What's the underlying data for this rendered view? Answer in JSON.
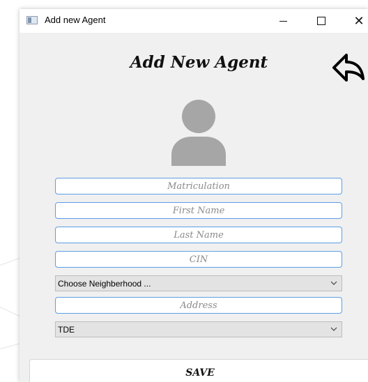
{
  "window": {
    "title": "Add new Agent",
    "minimize_icon": "minimize-icon",
    "maximize_icon": "maximize-icon",
    "close_icon": "close-icon"
  },
  "form": {
    "heading": "Add New Agent",
    "back_icon": "back-arrow-icon",
    "avatar_icon": "user-avatar-icon",
    "fields": {
      "matriculation": {
        "placeholder": "Matriculation",
        "value": ""
      },
      "first_name": {
        "placeholder": "First Name",
        "value": ""
      },
      "last_name": {
        "placeholder": "Last Name",
        "value": ""
      },
      "cin": {
        "placeholder": "CIN",
        "value": ""
      },
      "neighborhood": {
        "selected": "Choose Neighberhood ..."
      },
      "address": {
        "placeholder": "Address",
        "value": ""
      },
      "type": {
        "selected": "TDE"
      }
    },
    "save_label": "SAVE"
  },
  "colors": {
    "window_bg": "#f0f0f0",
    "field_border": "#5b9ee6",
    "select_bg": "#e3e3e3",
    "avatar": "#a6a6a6"
  }
}
